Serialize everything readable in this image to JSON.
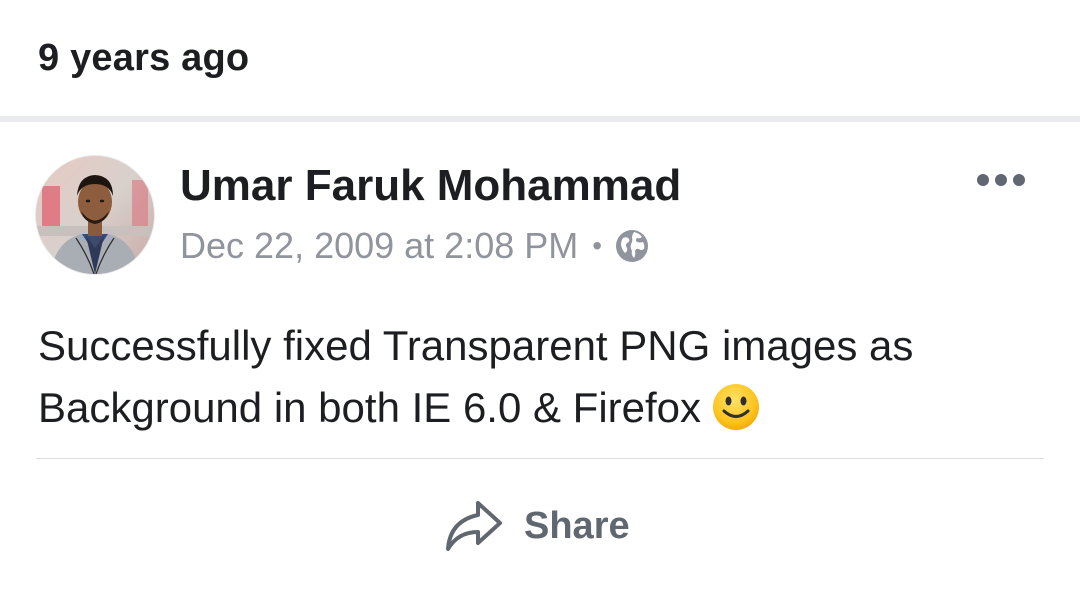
{
  "memory": {
    "title": "9 years ago"
  },
  "post": {
    "author": "Umar Faruk Mohammad",
    "timestamp": "Dec 22, 2009 at 2:08 PM",
    "separator": "•",
    "privacy_icon": "globe-icon",
    "more_icon": "more-options-icon",
    "text": "Successfully fixed Transparent PNG images as Background in both IE 6.0 & Firefox",
    "emoji": "slightly-smiling-face",
    "share_label": "Share",
    "share_icon": "share-arrow-icon"
  },
  "colors": {
    "text_primary": "#1c1e21",
    "text_secondary": "#90949c",
    "icon_gray": "#606770",
    "divider": "#dadde1",
    "section_gap": "#e9ebee"
  }
}
